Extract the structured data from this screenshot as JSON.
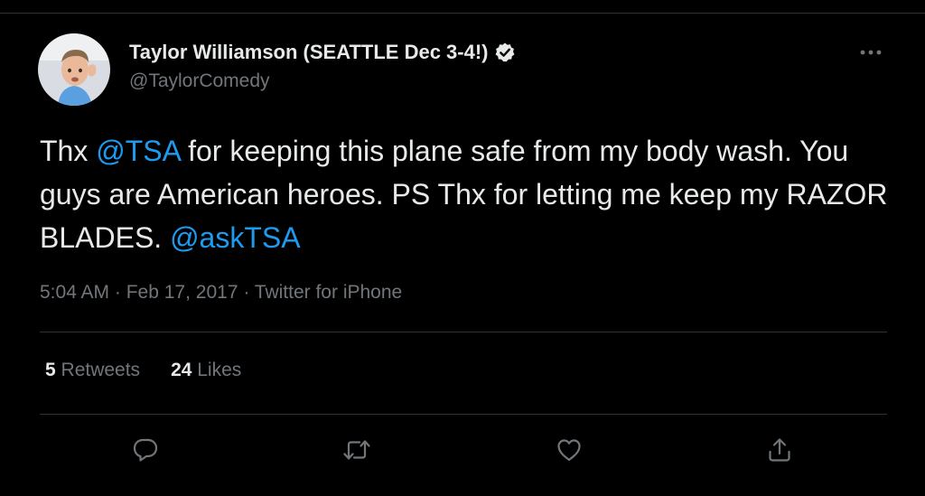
{
  "tweet": {
    "author": {
      "display_name": "Taylor Williamson (SEATTLE Dec 3-4!)",
      "handle": "@TaylorComedy",
      "verified": true
    },
    "text": {
      "part1": "Thx ",
      "mention1": "@TSA",
      "part2": " for keeping this plane safe from my body wash. You guys are American heroes. PS Thx for letting me keep my RAZOR BLADES. ",
      "mention2": "@askTSA"
    },
    "meta": {
      "time": "5:04 AM",
      "separator1": " · ",
      "date": "Feb 17, 2017",
      "separator2": " · ",
      "source": "Twitter for iPhone"
    },
    "stats": {
      "retweets_count": "5",
      "retweets_label": " Retweets",
      "likes_count": "24",
      "likes_label": " Likes"
    },
    "actions": {
      "reply_icon": "reply-icon",
      "retweet_icon": "retweet-icon",
      "like_icon": "heart-icon",
      "share_icon": "share-icon",
      "more_icon": "more-icon"
    }
  },
  "colors": {
    "background": "#000000",
    "text_primary": "#e7e9ea",
    "text_secondary": "#71767b",
    "link": "#1d9bf0",
    "divider": "#2f3336"
  }
}
